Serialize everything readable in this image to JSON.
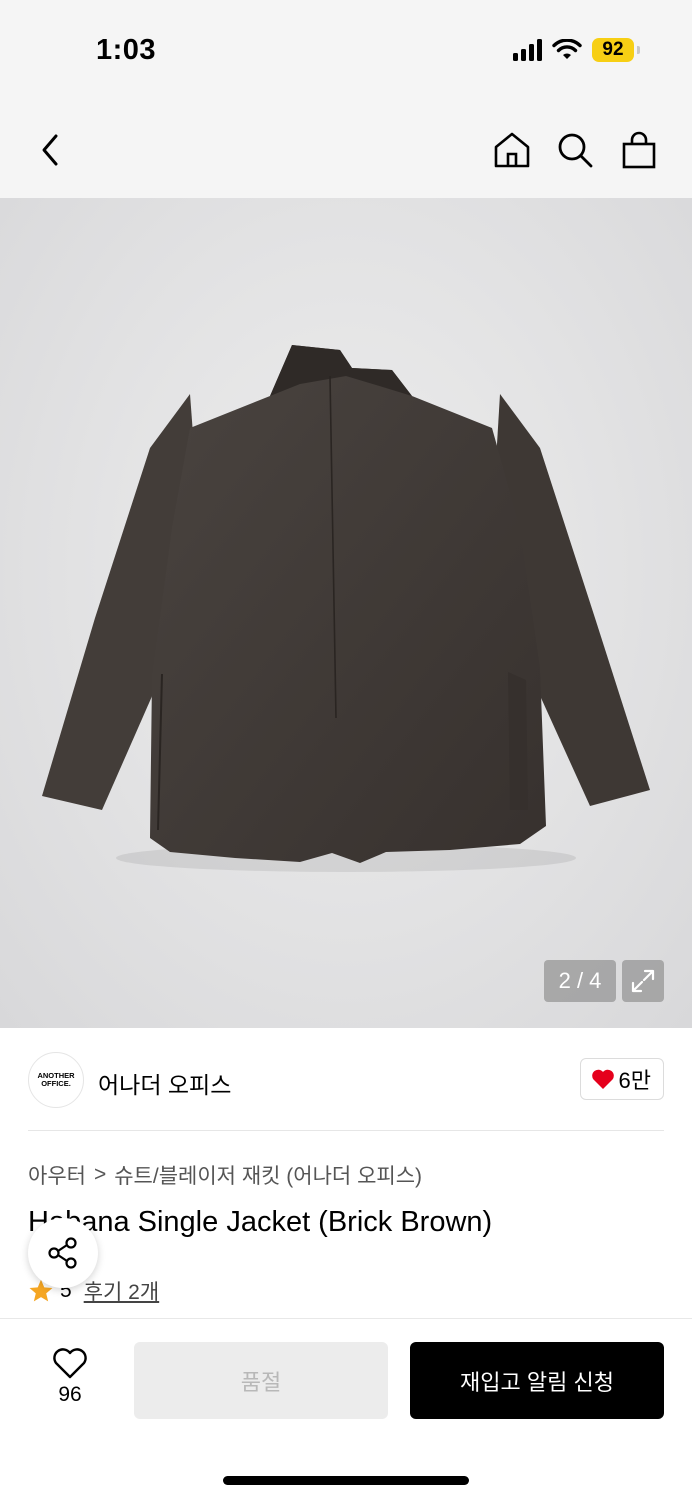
{
  "status_bar": {
    "time": "1:03",
    "battery": "92"
  },
  "nav": {
    "icons": [
      "chevron-left-icon",
      "home-icon",
      "search-icon",
      "shopping-bag-icon"
    ]
  },
  "gallery": {
    "counter": "2 / 4"
  },
  "brand": {
    "logo_line1": "ANOTHER",
    "logo_line2": "OFFICE.",
    "name": "어나더 오피스",
    "likes": "6만"
  },
  "breadcrumb": {
    "category": "아우터",
    "separator": ">",
    "subcategory": "슈트/블레이저 재킷 (어나더 오피스)"
  },
  "product": {
    "title": "Habana Single Jacket (Brick Brown)",
    "rating": "5",
    "reviews": "후기 2개"
  },
  "bottom": {
    "wish_count": "96",
    "soldout_label": "품절",
    "restock_label": "재입고 알림 신청"
  },
  "colors": {
    "accent": "#000000",
    "like_heart": "#e5001c",
    "star": "#f5a623",
    "battery": "#f7cf14",
    "jacket": "#3f3935"
  }
}
